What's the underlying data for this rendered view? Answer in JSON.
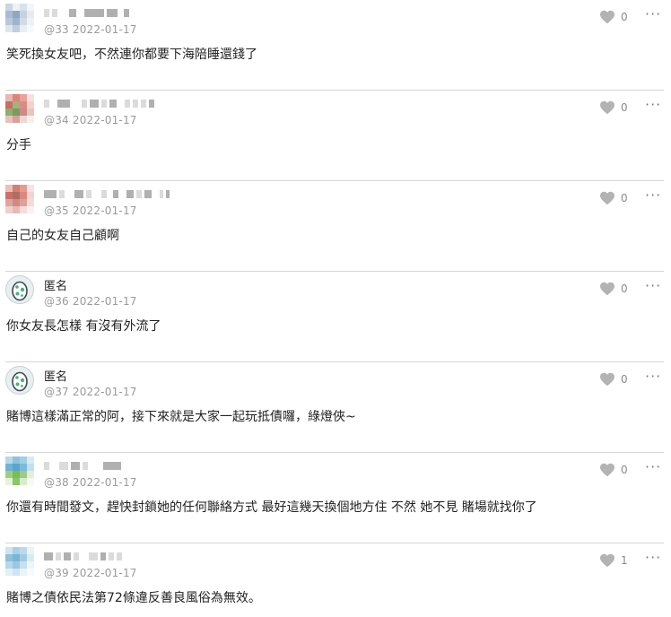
{
  "comments": [
    {
      "floor": "@33",
      "date": "2022-01-17",
      "author": "",
      "text": "笑死換女友吧，不然連你都要下海陪睡還錢了",
      "likes": "0",
      "anonymous": false
    },
    {
      "floor": "@34",
      "date": "2022-01-17",
      "author": "",
      "text": "分手",
      "likes": "0",
      "anonymous": false
    },
    {
      "floor": "@35",
      "date": "2022-01-17",
      "author": "",
      "text": "自己的女友自己顧啊",
      "likes": "0",
      "anonymous": false
    },
    {
      "floor": "@36",
      "date": "2022-01-17",
      "author": "匿名",
      "text": "你女友長怎樣 有沒有外流了",
      "likes": "0",
      "anonymous": true
    },
    {
      "floor": "@37",
      "date": "2022-01-17",
      "author": "匿名",
      "text": "賭博這樣滿正常的阿，接下來就是大家一起玩抵債囉，綠燈俠~",
      "likes": "0",
      "anonymous": true
    },
    {
      "floor": "@38",
      "date": "2022-01-17",
      "author": "",
      "text": "你還有時間發文，趕快封鎖她的任何聯絡方式 最好這幾天換個地方住 不然 她不見 賭場就找你了",
      "likes": "0",
      "anonymous": false
    },
    {
      "floor": "@39",
      "date": "2022-01-17",
      "author": "",
      "text": "賭博之債依民法第72條違反善良風俗為無效。",
      "likes": "1",
      "anonymous": false
    }
  ],
  "icons": {
    "like": "heart-icon",
    "more": "more-options-icon",
    "anonymous_avatar": "egg-avatar-icon"
  },
  "colors": {
    "text": "#222222",
    "meta": "#9a9a9a",
    "divider": "#d6d6d6",
    "heart": "#b3b3b3"
  }
}
